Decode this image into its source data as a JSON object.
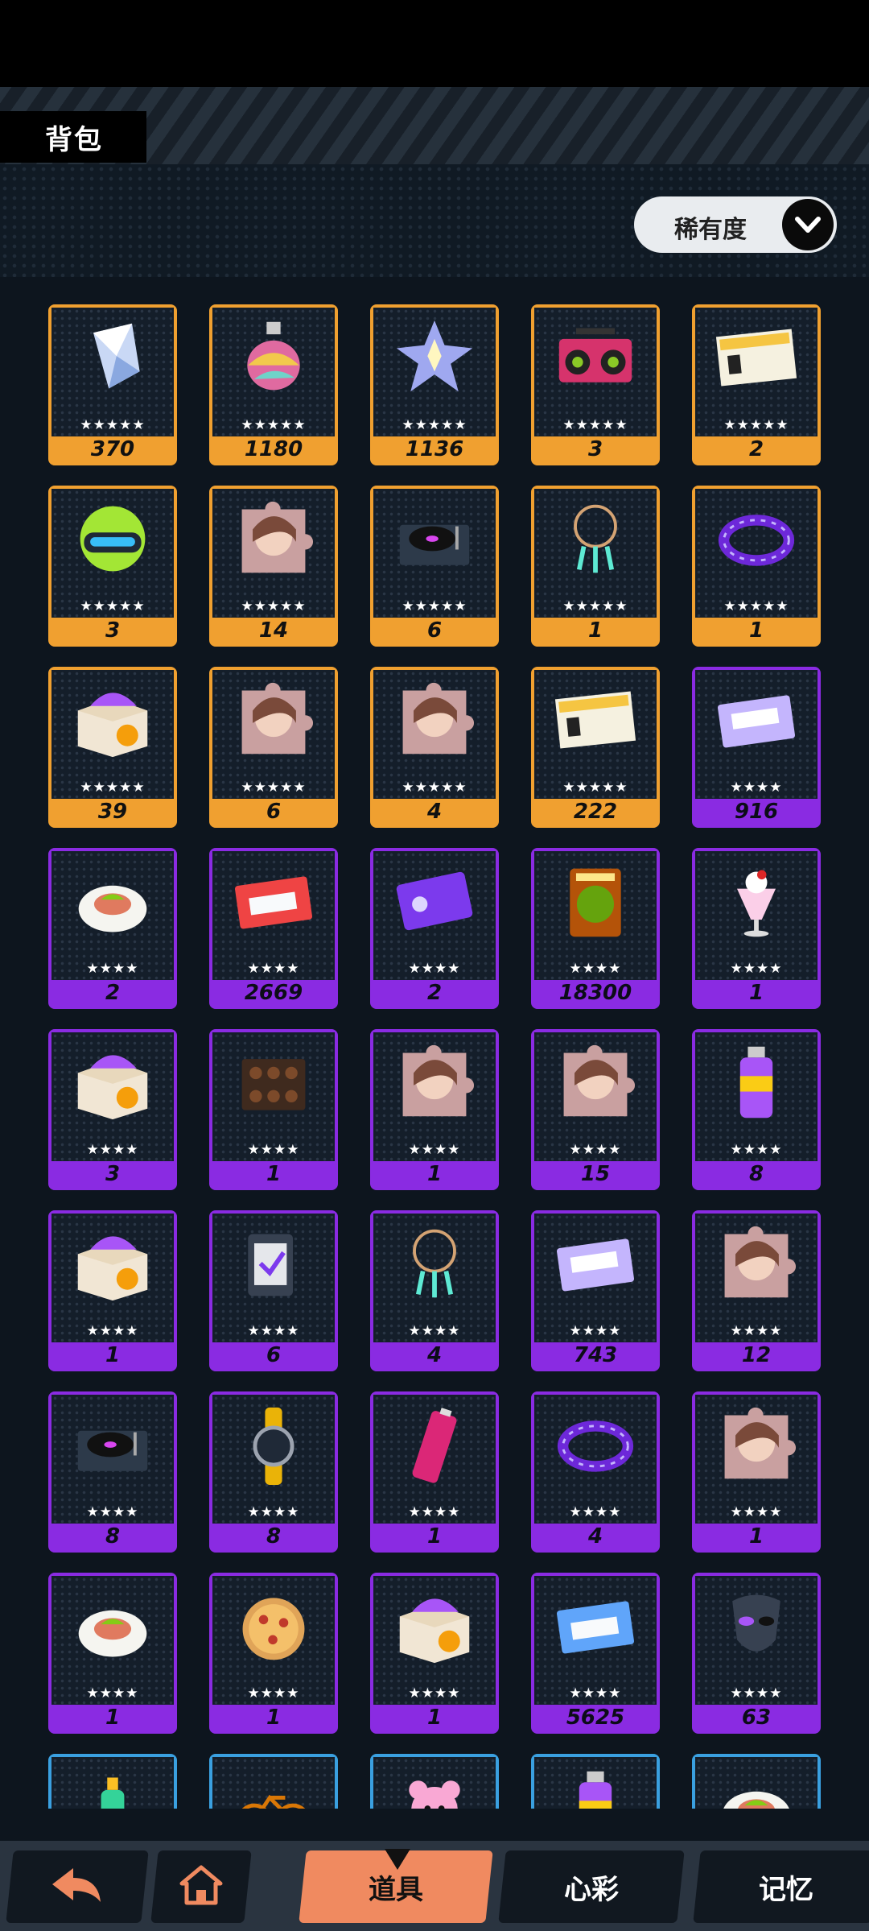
{
  "header": {
    "title": "背包"
  },
  "sort": {
    "label": "稀有度",
    "icon": "chevron-down-icon"
  },
  "colors": {
    "rarity5": "#f0a030",
    "rarity4": "#8a2be2",
    "rarity3": "#3aa0e0",
    "activeTab": "#f08a60"
  },
  "items": [
    {
      "icon": "crystal-icon",
      "rarity": 5,
      "stars": "★★★★★",
      "count": "370"
    },
    {
      "icon": "potion-icon",
      "rarity": 5,
      "stars": "★★★★★",
      "count": "1180"
    },
    {
      "icon": "star-crystal-icon",
      "rarity": 5,
      "stars": "★★★★★",
      "count": "1136"
    },
    {
      "icon": "boombox-icon",
      "rarity": 5,
      "stars": "★★★★★",
      "count": "3"
    },
    {
      "icon": "ticket-icon",
      "rarity": 5,
      "stars": "★★★★★",
      "count": "2"
    },
    {
      "icon": "helmet-icon",
      "rarity": 5,
      "stars": "★★★★★",
      "count": "3"
    },
    {
      "icon": "puzzle-portrait-icon",
      "rarity": 5,
      "stars": "★★★★★",
      "count": "14"
    },
    {
      "icon": "turntable-icon",
      "rarity": 5,
      "stars": "★★★★★",
      "count": "6"
    },
    {
      "icon": "dreamcatcher-icon",
      "rarity": 5,
      "stars": "★★★★★",
      "count": "1"
    },
    {
      "icon": "collar-icon",
      "rarity": 5,
      "stars": "★★★★★",
      "count": "1"
    },
    {
      "icon": "gift-box-icon",
      "rarity": 5,
      "stars": "★★★★★",
      "count": "39"
    },
    {
      "icon": "puzzle-portrait-icon",
      "rarity": 5,
      "stars": "★★★★★",
      "count": "6"
    },
    {
      "icon": "puzzle-portrait-icon",
      "rarity": 5,
      "stars": "★★★★★",
      "count": "4"
    },
    {
      "icon": "ticket-icon",
      "rarity": 5,
      "stars": "★★★★★",
      "count": "222"
    },
    {
      "icon": "cassette-icon",
      "rarity": 4,
      "stars": "★★★★",
      "count": "916"
    },
    {
      "icon": "food-plate-icon",
      "rarity": 4,
      "stars": "★★★★",
      "count": "2"
    },
    {
      "icon": "cassette-fire-icon",
      "rarity": 4,
      "stars": "★★★★",
      "count": "2669"
    },
    {
      "icon": "mystery-ticket-icon",
      "rarity": 4,
      "stars": "★★★★",
      "count": "2"
    },
    {
      "icon": "trex-ticket-icon",
      "rarity": 4,
      "stars": "★★★★",
      "count": "18300"
    },
    {
      "icon": "parfait-icon",
      "rarity": 4,
      "stars": "★★★★",
      "count": "1"
    },
    {
      "icon": "gift-box-icon",
      "rarity": 4,
      "stars": "★★★★",
      "count": "3"
    },
    {
      "icon": "chocolate-box-icon",
      "rarity": 4,
      "stars": "★★★★",
      "count": "1"
    },
    {
      "icon": "puzzle-portrait-icon",
      "rarity": 4,
      "stars": "★★★★",
      "count": "1"
    },
    {
      "icon": "puzzle-portrait-icon",
      "rarity": 4,
      "stars": "★★★★",
      "count": "15"
    },
    {
      "icon": "spray-can-icon",
      "rarity": 4,
      "stars": "★★★★",
      "count": "8"
    },
    {
      "icon": "gift-box-icon",
      "rarity": 4,
      "stars": "★★★★",
      "count": "1"
    },
    {
      "icon": "memory-film-icon",
      "rarity": 4,
      "stars": "★★★★",
      "count": "6"
    },
    {
      "icon": "dreamcatcher-icon",
      "rarity": 4,
      "stars": "★★★★",
      "count": "4"
    },
    {
      "icon": "cassette-icon",
      "rarity": 4,
      "stars": "★★★★",
      "count": "743"
    },
    {
      "icon": "puzzle-portrait-icon",
      "rarity": 4,
      "stars": "★★★★",
      "count": "12"
    },
    {
      "icon": "turntable-icon",
      "rarity": 4,
      "stars": "★★★★",
      "count": "8"
    },
    {
      "icon": "watch-icon",
      "rarity": 4,
      "stars": "★★★★",
      "count": "8"
    },
    {
      "icon": "battery-icon",
      "rarity": 4,
      "stars": "★★★★",
      "count": "1"
    },
    {
      "icon": "collar-icon",
      "rarity": 4,
      "stars": "★★★★",
      "count": "4"
    },
    {
      "icon": "puzzle-portrait-icon",
      "rarity": 4,
      "stars": "★★★★",
      "count": "1"
    },
    {
      "icon": "food-plate-icon",
      "rarity": 4,
      "stars": "★★★★",
      "count": "1"
    },
    {
      "icon": "pizza-icon",
      "rarity": 4,
      "stars": "★★★★",
      "count": "1"
    },
    {
      "icon": "gift-box-icon",
      "rarity": 4,
      "stars": "★★★★",
      "count": "1"
    },
    {
      "icon": "cassette-ice-icon",
      "rarity": 4,
      "stars": "★★★★",
      "count": "5625"
    },
    {
      "icon": "mask-icon",
      "rarity": 4,
      "stars": "★★★★",
      "count": "63"
    },
    {
      "icon": "bottle-icon",
      "rarity": 3,
      "stars": "",
      "count": ""
    },
    {
      "icon": "bicycle-icon",
      "rarity": 3,
      "stars": "",
      "count": ""
    },
    {
      "icon": "plush-icon",
      "rarity": 3,
      "stars": "",
      "count": ""
    },
    {
      "icon": "spray-can-icon",
      "rarity": 3,
      "stars": "",
      "count": ""
    },
    {
      "icon": "food-plate-icon",
      "rarity": 3,
      "stars": "",
      "count": ""
    }
  ],
  "nav": {
    "back_icon": "back-arrow-icon",
    "home_icon": "home-icon",
    "tabs": [
      {
        "label": "道具",
        "active": true
      },
      {
        "label": "心彩",
        "active": false
      },
      {
        "label": "记忆",
        "active": false
      }
    ]
  }
}
